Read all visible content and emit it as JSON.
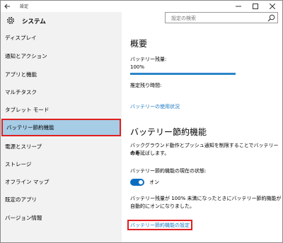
{
  "titlebar": {
    "title": "設定"
  },
  "sidebar": {
    "header": "システム",
    "items": [
      {
        "label": "ディスプレイ"
      },
      {
        "label": "通知とアクション"
      },
      {
        "label": "アプリと機能"
      },
      {
        "label": "マルチタスク"
      },
      {
        "label": "タブレット モード"
      },
      {
        "label": "バッテリー節約機能"
      },
      {
        "label": "電源とスリープ"
      },
      {
        "label": "ストレージ"
      },
      {
        "label": "オフライン マップ"
      },
      {
        "label": "既定のアプリ"
      },
      {
        "label": "バージョン情報"
      }
    ]
  },
  "search": {
    "placeholder": "設定の検索"
  },
  "main": {
    "overview_title": "概要",
    "battery_remaining_label": "バッテリー残量:",
    "battery_percent": "100%",
    "battery_fraction": 1.0,
    "estimated_time_label": "推定残り時間:",
    "usage_link": "バッテリーの使用状況",
    "saver_title": "バッテリー節約機能",
    "saver_desc_line1": "バックグラウンド動作とプッシュ通知を制限することでバッテリーの寿",
    "saver_desc_line2": "命を延ばします。",
    "current_state_label": "バッテリー節約機能の現在の状態:",
    "toggle_label": "オン",
    "auto_line1": "バッテリー残量が 100% 未満になったときにバッテリー節約機能が",
    "auto_line2": "自動的にオンになりました。",
    "settings_link": "バッテリー節約機能の設定"
  },
  "colors": {
    "accent": "#0a6cc0",
    "selected_bg": "#a6cce6",
    "highlight": "#e02020",
    "link": "#1a78c2"
  }
}
